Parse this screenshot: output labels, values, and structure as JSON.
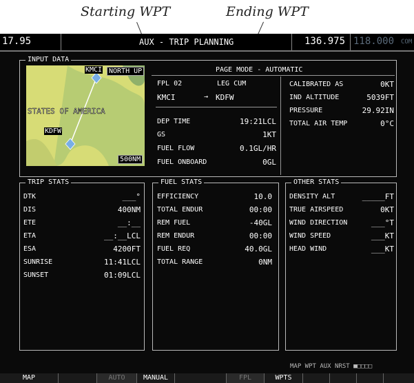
{
  "callouts": {
    "start": "Starting WPT",
    "end": "Ending WPT"
  },
  "top_bar": {
    "nav_freq": "17.95",
    "title": "AUX - TRIP PLANNING",
    "com_standby": "136.975",
    "com_active": "118.000",
    "com_label": "COM"
  },
  "input_data": {
    "legend": "INPUT DATA",
    "map": {
      "orientation": "NORTH UP",
      "label": "STATES OF AMERICA",
      "wpt_start": "KMCI",
      "wpt_end": "KDFW",
      "range": "500NM"
    },
    "page_mode": "PAGE MODE - AUTOMATIC",
    "fpl": "FPL 02",
    "leg": "LEG CUM",
    "route_from": "KMCI",
    "route_arrow": "→",
    "route_to": "KDFW",
    "rows": [
      {
        "label": "DEP TIME",
        "value": "19:21LCL"
      },
      {
        "label": "GS",
        "value": "1KT"
      },
      {
        "label": "FUEL FLOW",
        "value": "0.1GL/HR"
      },
      {
        "label": "FUEL ONBOARD",
        "value": "0GL"
      }
    ],
    "right_rows": [
      {
        "label": "CALIBRATED AS",
        "value": "0KT"
      },
      {
        "label": "IND ALTITUDE",
        "value": "5039FT"
      },
      {
        "label": "PRESSURE",
        "value": "29.92IN"
      },
      {
        "label": "TOTAL AIR TEMP",
        "value": "0°C"
      }
    ]
  },
  "trip_stats": {
    "legend": "TRIP STATS",
    "rows": [
      {
        "label": "DTK",
        "value": "___°"
      },
      {
        "label": "DIS",
        "value": "400NM"
      },
      {
        "label": "ETE",
        "value": "__:__"
      },
      {
        "label": "ETA",
        "value": "__:__LCL"
      },
      {
        "label": "ESA",
        "value": "4200FT"
      },
      {
        "label": "SUNRISE",
        "value": "11:41LCL"
      },
      {
        "label": "SUNSET",
        "value": "01:09LCL"
      }
    ]
  },
  "fuel_stats": {
    "legend": "FUEL STATS",
    "rows": [
      {
        "label": "EFFICIENCY",
        "value": "10.0"
      },
      {
        "label": "TOTAL ENDUR",
        "value": "00:00"
      },
      {
        "label": "REM FUEL",
        "value": "-40GL"
      },
      {
        "label": "REM ENDUR",
        "value": "00:00"
      },
      {
        "label": "FUEL REQ",
        "value": "40.0GL"
      },
      {
        "label": "TOTAL RANGE",
        "value": "0NM"
      }
    ]
  },
  "other_stats": {
    "legend": "OTHER STATS",
    "rows": [
      {
        "label": "DENSITY ALT",
        "value": "_____FT"
      },
      {
        "label": "TRUE AIRSPEED",
        "value": "0KT"
      },
      {
        "label": "WIND DIRECTION",
        "value": "___°T"
      },
      {
        "label": "WIND SPEED",
        "value": "___KT"
      },
      {
        "label": "HEAD WIND",
        "value": "___KT"
      }
    ]
  },
  "page_group": "MAP WPT AUX NRST ■□□□□",
  "softkeys": [
    {
      "label": "MAP",
      "color": "#ffffff"
    },
    {
      "label": "",
      "color": "#ffffff"
    },
    {
      "label": "AUTO",
      "color": "#777777"
    },
    {
      "label": "MANUAL",
      "color": "#ffffff"
    },
    {
      "label": "",
      "color": "#ffffff"
    },
    {
      "label": "FPL",
      "color": "#777777"
    },
    {
      "label": "WPTS",
      "color": "#ffffff"
    },
    {
      "label": "",
      "color": "#ffffff"
    },
    {
      "label": "",
      "color": "#ffffff"
    },
    {
      "label": "",
      "color": "#ffffff"
    },
    {
      "label": "",
      "color": "#ffffff"
    }
  ],
  "colors": {
    "standby_freq_bg": "#0b0b0b",
    "active_freq": "#5a6a7a",
    "map_land": "#d7dc76",
    "map_terrain": "#9fbf6c",
    "waypoint": "#78aee6"
  }
}
